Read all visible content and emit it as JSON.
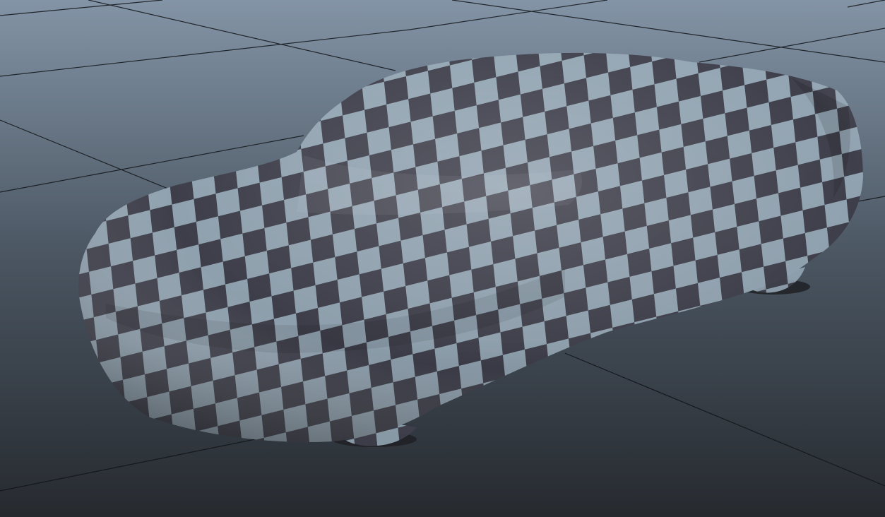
{
  "viewport": {
    "background_top": "#8394a6",
    "background_mid": "#4a5561",
    "background_bottom": "#262a2f",
    "grid_line_color": "#111418",
    "grid_visible": true
  },
  "scene_object": {
    "icon": "draped-cloth-car-cover",
    "material": "checker-texture",
    "checker_light_color": "#94a6b4",
    "checker_dark_color": "#3f404c",
    "shadow_color": "#1e2024"
  }
}
